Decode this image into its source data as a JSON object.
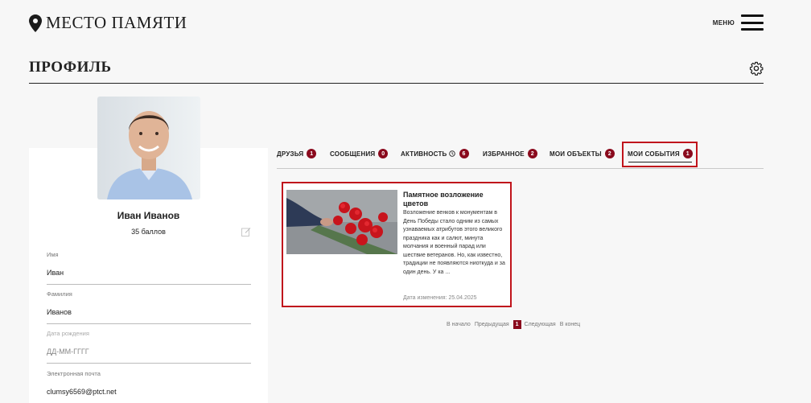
{
  "header": {
    "logo_text": "МЕСТО ПАМЯТИ",
    "menu_label": "МЕНЮ"
  },
  "page": {
    "title": "ПРОФИЛЬ"
  },
  "profile": {
    "name": "Иван Иванов",
    "points": "35 баллов",
    "fields": [
      {
        "label": "Имя",
        "value": "Иван"
      },
      {
        "label": "Фамилия",
        "value": "Иванов"
      },
      {
        "label": "Дата рождения",
        "placeholder": "ДД-ММ-ГГГГ"
      },
      {
        "label": "Электронная почта",
        "value": "clumsy6569@ptct.net"
      }
    ]
  },
  "tabs": [
    {
      "label": "ДРУЗЬЯ",
      "count": "1"
    },
    {
      "label": "СООБЩЕНИЯ",
      "count": "0"
    },
    {
      "label": "АКТИВНОСТЬ",
      "count": "6"
    },
    {
      "label": "ИЗБРАННОЕ",
      "count": "2"
    },
    {
      "label": "МОИ ОБЪЕКТЫ",
      "count": "2"
    },
    {
      "label": "МОИ СОБЫТИЯ",
      "count": "1",
      "active": true
    }
  ],
  "event": {
    "title": "Памятное возложение цветов",
    "text": "Возложение венков к монументам в День Победы стало одним из самых узнаваемых атрибутов этого великого праздника как и салют, минута молчания и военный парад или шествие ветеранов. Но, как известно, традиции не появляются ниоткуда и за один день. У ка ...",
    "date": "Дата изменения: 25.04.2025"
  },
  "pagination": {
    "first": "В начало",
    "prev": "Предыдущая",
    "current": "1",
    "next": "Следующая",
    "last": "В конец"
  },
  "colors": {
    "accent": "#8a0a1d",
    "highlight": "#c0141c"
  }
}
